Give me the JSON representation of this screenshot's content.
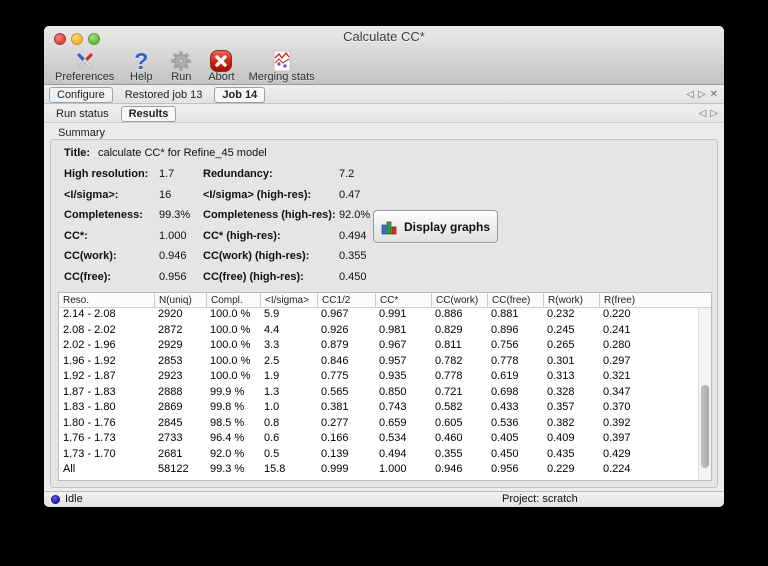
{
  "window": {
    "title": "Calculate CC*"
  },
  "toolbar": {
    "items": [
      {
        "label": "Preferences"
      },
      {
        "label": "Help"
      },
      {
        "label": "Run"
      },
      {
        "label": "Abort"
      },
      {
        "label": "Merging stats"
      }
    ]
  },
  "tabs": {
    "items": [
      {
        "label": "Configure"
      },
      {
        "label": "Restored job 13"
      },
      {
        "label": "Job 14"
      }
    ],
    "active": "Job 14"
  },
  "subtabs": {
    "items": [
      {
        "label": "Run status"
      },
      {
        "label": "Results"
      }
    ],
    "active": "Results"
  },
  "summary": {
    "group_label": "Summary",
    "title_label": "Title:",
    "title_value": "calculate CC* for Refine_45 model",
    "rows": [
      {
        "l1": "High resolution:",
        "v1": "1.7",
        "l2": "Redundancy:",
        "v2": "7.2"
      },
      {
        "l1": "<I/sigma>:",
        "v1": "16",
        "l2": "<I/sigma> (high-res):",
        "v2": "0.47"
      },
      {
        "l1": "Completeness:",
        "v1": "99.3%",
        "l2": "Completeness (high-res):",
        "v2": "92.0%"
      },
      {
        "l1": "CC*:",
        "v1": "1.000",
        "l2": "CC* (high-res):",
        "v2": "0.494"
      },
      {
        "l1": "CC(work):",
        "v1": "0.946",
        "l2": "CC(work) (high-res):",
        "v2": "0.355"
      },
      {
        "l1": "CC(free):",
        "v1": "0.956",
        "l2": "CC(free) (high-res):",
        "v2": "0.450"
      }
    ],
    "display_graphs_button": "Display graphs"
  },
  "table": {
    "columns": [
      "Reso.",
      "N(uniq)",
      "Compl.",
      "<I/sigma>",
      "CC1/2",
      "CC*",
      "CC(work)",
      "CC(free)",
      "R(work)",
      "R(free)"
    ],
    "rows": [
      [
        "2.14 - 2.08",
        "2920",
        "100.0 %",
        "5.9",
        "0.967",
        "0.991",
        "0.886",
        "0.881",
        "0.232",
        "0.220"
      ],
      [
        "2.08 - 2.02",
        "2872",
        "100.0 %",
        "4.4",
        "0.926",
        "0.981",
        "0.829",
        "0.896",
        "0.245",
        "0.241"
      ],
      [
        "2.02 - 1.96",
        "2929",
        "100.0 %",
        "3.3",
        "0.879",
        "0.967",
        "0.811",
        "0.756",
        "0.265",
        "0.280"
      ],
      [
        "1.96 - 1.92",
        "2853",
        "100.0 %",
        "2.5",
        "0.846",
        "0.957",
        "0.782",
        "0.778",
        "0.301",
        "0.297"
      ],
      [
        "1.92 - 1.87",
        "2923",
        "100.0 %",
        "1.9",
        "0.775",
        "0.935",
        "0.778",
        "0.619",
        "0.313",
        "0.321"
      ],
      [
        "1.87 - 1.83",
        "2888",
        "99.9 %",
        "1.3",
        "0.565",
        "0.850",
        "0.721",
        "0.698",
        "0.328",
        "0.347"
      ],
      [
        "1.83 - 1.80",
        "2869",
        "99.8 %",
        "1.0",
        "0.381",
        "0.743",
        "0.582",
        "0.433",
        "0.357",
        "0.370"
      ],
      [
        "1.80 - 1.76",
        "2845",
        "98.5 %",
        "0.8",
        "0.277",
        "0.659",
        "0.605",
        "0.536",
        "0.382",
        "0.392"
      ],
      [
        "1.76 - 1.73",
        "2733",
        "96.4 %",
        "0.6",
        "0.166",
        "0.534",
        "0.460",
        "0.405",
        "0.409",
        "0.397"
      ],
      [
        "1.73 - 1.70",
        "2681",
        "92.0 %",
        "0.5",
        "0.139",
        "0.494",
        "0.355",
        "0.450",
        "0.435",
        "0.429"
      ],
      [
        "All",
        "58122",
        "99.3 %",
        "15.8",
        "0.999",
        "1.000",
        "0.946",
        "0.956",
        "0.229",
        "0.224"
      ]
    ]
  },
  "statusbar": {
    "status": "Idle",
    "project": "Project: scratch"
  },
  "colors": {
    "abort_red": "#c41a10",
    "help_blue": "#2a66c8",
    "graph_blue": "#3a6fd8",
    "graph_green": "#2f9e3a",
    "graph_red": "#d0342c",
    "status_dot_blue": "#2018b8"
  }
}
